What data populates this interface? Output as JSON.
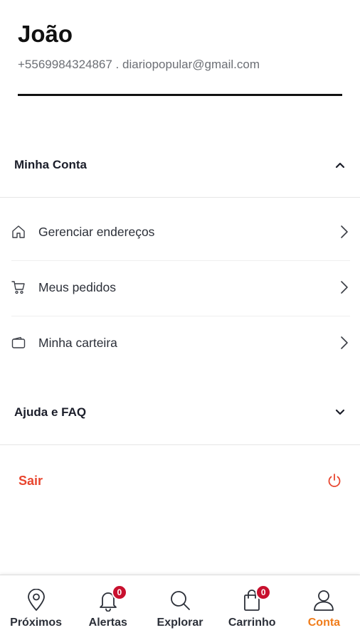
{
  "profile": {
    "name": "João",
    "contact": "+5569984324867 . diariopopular@gmail.com"
  },
  "account_section": {
    "title": "Minha Conta",
    "items": [
      {
        "label": "Gerenciar endereços",
        "icon": "home-icon"
      },
      {
        "label": "Meus pedidos",
        "icon": "cart-icon"
      },
      {
        "label": "Minha carteira",
        "icon": "wallet-icon"
      }
    ]
  },
  "help_section": {
    "title": "Ajuda e FAQ"
  },
  "logout": {
    "label": "Sair",
    "icon": "power-icon",
    "color": "#e8462f"
  },
  "tabbar": {
    "tabs": [
      {
        "label": "Próximos",
        "icon": "location-pin-icon"
      },
      {
        "label": "Alertas",
        "icon": "bell-icon",
        "badge": "0"
      },
      {
        "label": "Explorar",
        "icon": "search-icon"
      },
      {
        "label": "Carrinho",
        "icon": "shopping-bag-icon",
        "badge": "0"
      },
      {
        "label": "Conta",
        "icon": "user-icon",
        "active": true
      }
    ],
    "active_color": "#f07c1a",
    "badge_color": "#c8102e"
  }
}
